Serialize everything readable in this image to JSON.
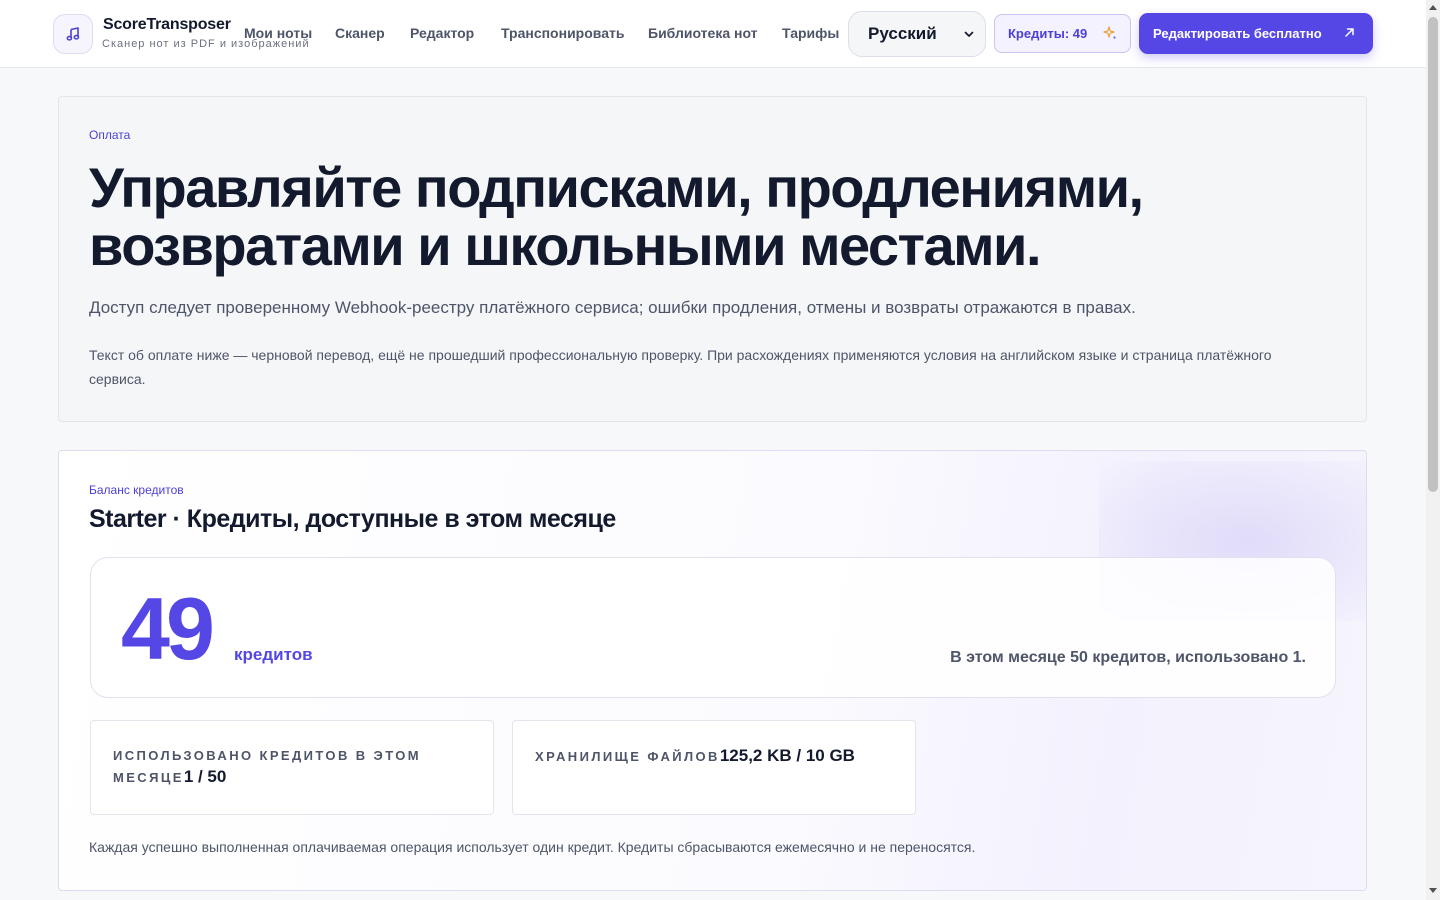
{
  "header": {
    "brand_name": "ScoreTransposer",
    "brand_tagline": "Сканер нот из PDF и изображений",
    "logo_icon": "music-note-icon",
    "nav": [
      {
        "label": "Мои ноты"
      },
      {
        "label": "Сканер"
      },
      {
        "label": "Редактор"
      },
      {
        "label": "Транспонировать"
      },
      {
        "label": "Библиотека нот"
      },
      {
        "label": "Тарифы"
      }
    ],
    "language": {
      "selected": "Русский",
      "icon": "chevron-down-icon"
    },
    "credits_pill": {
      "label": "Кредиты: 49",
      "icon": "sparkle-icon"
    },
    "cta": {
      "label": "Редактировать бесплатно",
      "icon": "arrow-up-right-icon"
    }
  },
  "hero": {
    "eyebrow": "Оплата",
    "title": "Управляйте подписками, продлениями, возвратами и школьными местами.",
    "lead": "Доступ следует проверенному Webhook-реестру платёжного сервиса; ошибки продления, отмены и возвраты отражаются в правах.",
    "note": "Текст об оплате ниже — черновой перевод, ещё не прошедший профессиональную проверку. При расхождениях применяются условия на английском языке и страница платёжного сервиса."
  },
  "credits": {
    "eyebrow": "Баланс кредитов",
    "title": "Starter · Кредиты, доступные в этом месяце",
    "balance": "49",
    "balance_unit": "кредитов",
    "summary": "В этом месяце 50 кредитов, использовано 1.",
    "stats": [
      {
        "label": "Использовано кредитов в этом месяце",
        "value": "1 / 50"
      },
      {
        "label": "Хранилище файлов",
        "value": "125,2 KB / 10 GB"
      }
    ],
    "footnote": "Каждая успешно выполненная оплачиваемая операция использует один кредит. Кредиты сбрасываются ежемесячно и не переносятся."
  },
  "colors": {
    "accent": "#5546e6",
    "text": "#141a2e",
    "muted": "#4f5568",
    "background": "#f7f8fa"
  }
}
